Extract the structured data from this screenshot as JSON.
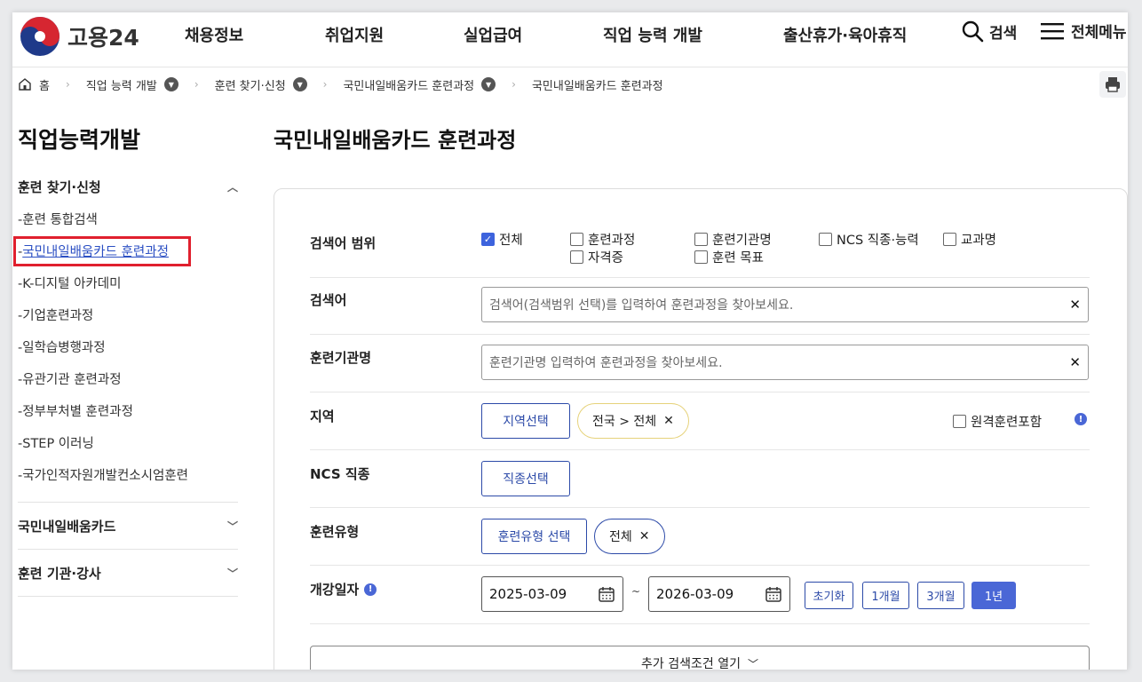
{
  "header": {
    "logo_text": "고용24",
    "nav": [
      "채용정보",
      "취업지원",
      "실업급여",
      "직업 능력 개발",
      "출산휴가·육아휴직"
    ],
    "search_label": "검색",
    "menu_label": "전체메뉴"
  },
  "breadcrumb": {
    "home": "홈",
    "items": [
      "직업 능력 개발",
      "훈련 찾기·신청",
      "국민내일배움카드 훈련과정",
      "국민내일배움카드 훈련과정"
    ]
  },
  "sidebar": {
    "title": "직업능력개발",
    "group1": {
      "label": "훈련 찾기·신청",
      "items": [
        "훈련 통합검색",
        "국민내일배움카드 훈련과정",
        "K-디지털 아카데미",
        "기업훈련과정",
        "일학습병행과정",
        "유관기관 훈련과정",
        "정부부처별 훈련과정",
        "STEP 이러닝",
        "국가인적자원개발컨소시엄훈련"
      ]
    },
    "group2": {
      "label": "국민내일배움카드"
    },
    "group3": {
      "label": "훈련 기관·강사"
    }
  },
  "main": {
    "title": "국민내일배움카드 훈련과정",
    "scope": {
      "label": "검색어 범위",
      "options": [
        "전체",
        "훈련과정",
        "훈련기관명",
        "NCS 직종·능력",
        "교과명",
        "자격증",
        "훈련 목표"
      ]
    },
    "keyword": {
      "label": "검색어",
      "placeholder": "검색어(검색범위 선택)를 입력하여 훈련과정을 찾아보세요."
    },
    "institution": {
      "label": "훈련기관명",
      "placeholder": "훈련기관명 입력하여 훈련과정을 찾아보세요."
    },
    "region": {
      "label": "지역",
      "button": "지역선택",
      "chip": "전국 > 전체",
      "remote_label": "원격훈련포함"
    },
    "ncs": {
      "label": "NCS 직종",
      "button": "직종선택"
    },
    "type": {
      "label": "훈련유형",
      "button": "훈련유형 선택",
      "chip": "전체"
    },
    "date": {
      "label": "개강일자",
      "start": "2025-03-09",
      "end": "2026-03-09",
      "tilde": "~",
      "buttons": [
        "초기화",
        "1개월",
        "3개월",
        "1년"
      ]
    },
    "more_label": "추가 검색조건 열기"
  }
}
